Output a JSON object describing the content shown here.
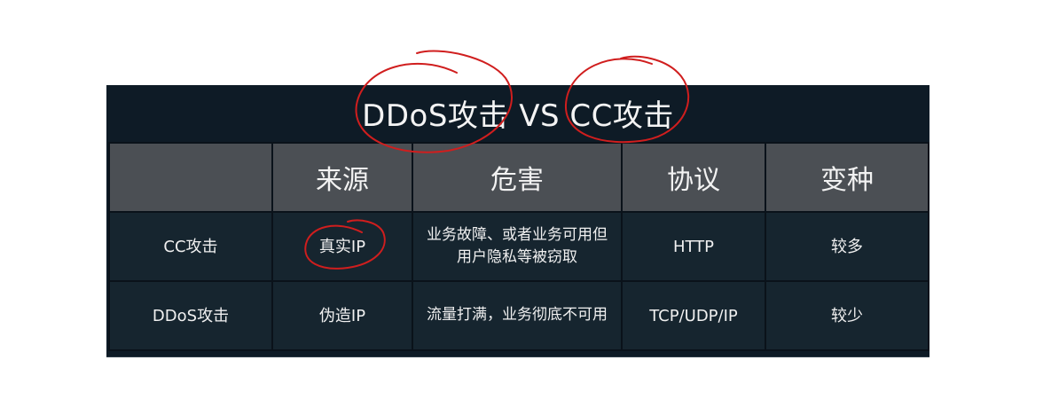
{
  "slide": {
    "title": "DDoS攻击 VS CC攻击"
  },
  "table": {
    "headers": [
      "",
      "来源",
      "危害",
      "协议",
      "变种"
    ],
    "rows": [
      {
        "name": "CC攻击",
        "source": "真实IP",
        "harm": "业务故障、或者业务可用但用户隐私等被窃取",
        "protocol": "HTTP",
        "variants": "较多"
      },
      {
        "name": "DDoS攻击",
        "source": "伪造IP",
        "harm": "流量打满，业务彻底不可用",
        "protocol": "TCP/UDP/IP",
        "variants": "较少"
      }
    ]
  },
  "colors": {
    "background": "#0e1b26",
    "header_cell": "#4b4f54",
    "body_cell": "#16252f",
    "annotation": "#d01e1e"
  }
}
